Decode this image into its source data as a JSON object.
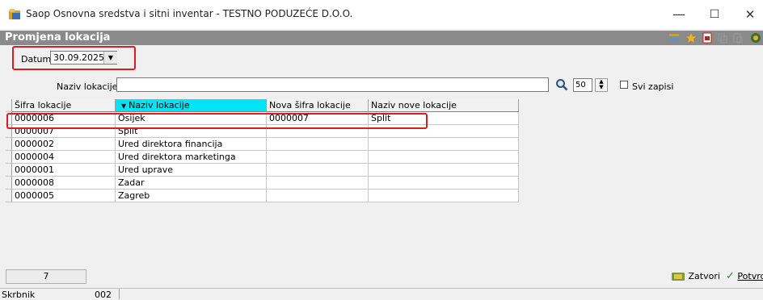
{
  "window": {
    "title": "Saop Osnovna sredstva i sitni inventar - TESTNO PODUZEĆE D.O.O.",
    "minimize": "—",
    "maximize": "☐",
    "close": "✕"
  },
  "form": {
    "title": "Promjena lokacija",
    "toolbar_icons": [
      "table-icon",
      "star-icon",
      "pdf-icon",
      "copy-icon",
      "paste-icon",
      "exit-icon"
    ]
  },
  "datum": {
    "label": "Datum",
    "value": "30.09.2025"
  },
  "search": {
    "label": "Naziv lokacije",
    "value": "",
    "count": "50",
    "checkbox_label": "Svi zapisi",
    "checkbox_checked": false
  },
  "table": {
    "columns": [
      "Šifra lokacije",
      "Naziv lokacije",
      "Nova šifra lokacije",
      "Naziv nove lokacije"
    ],
    "sorted_column": 1,
    "sort_arrow": "▼",
    "rows": [
      [
        "0000006",
        "Osijek",
        "0000007",
        "Split"
      ],
      [
        "0000007",
        "Split",
        "",
        ""
      ],
      [
        "0000002",
        "Ured direktora financija",
        "",
        ""
      ],
      [
        "0000004",
        "Ured direktora marketinga",
        "",
        ""
      ],
      [
        "0000001",
        "Ured uprave",
        "",
        ""
      ],
      [
        "0000008",
        "Zadar",
        "",
        ""
      ],
      [
        "0000005",
        "Zagreb",
        "",
        ""
      ]
    ]
  },
  "footer": {
    "record_count": "7",
    "close_button": "Zatvori",
    "confirm_button": "Potvrd"
  },
  "status": {
    "label": "Skrbnik",
    "value": "002"
  },
  "colors": {
    "highlight": "#d81e1e",
    "sorted_header": "#00e5f5",
    "form_bar": "#8a8a8a"
  }
}
